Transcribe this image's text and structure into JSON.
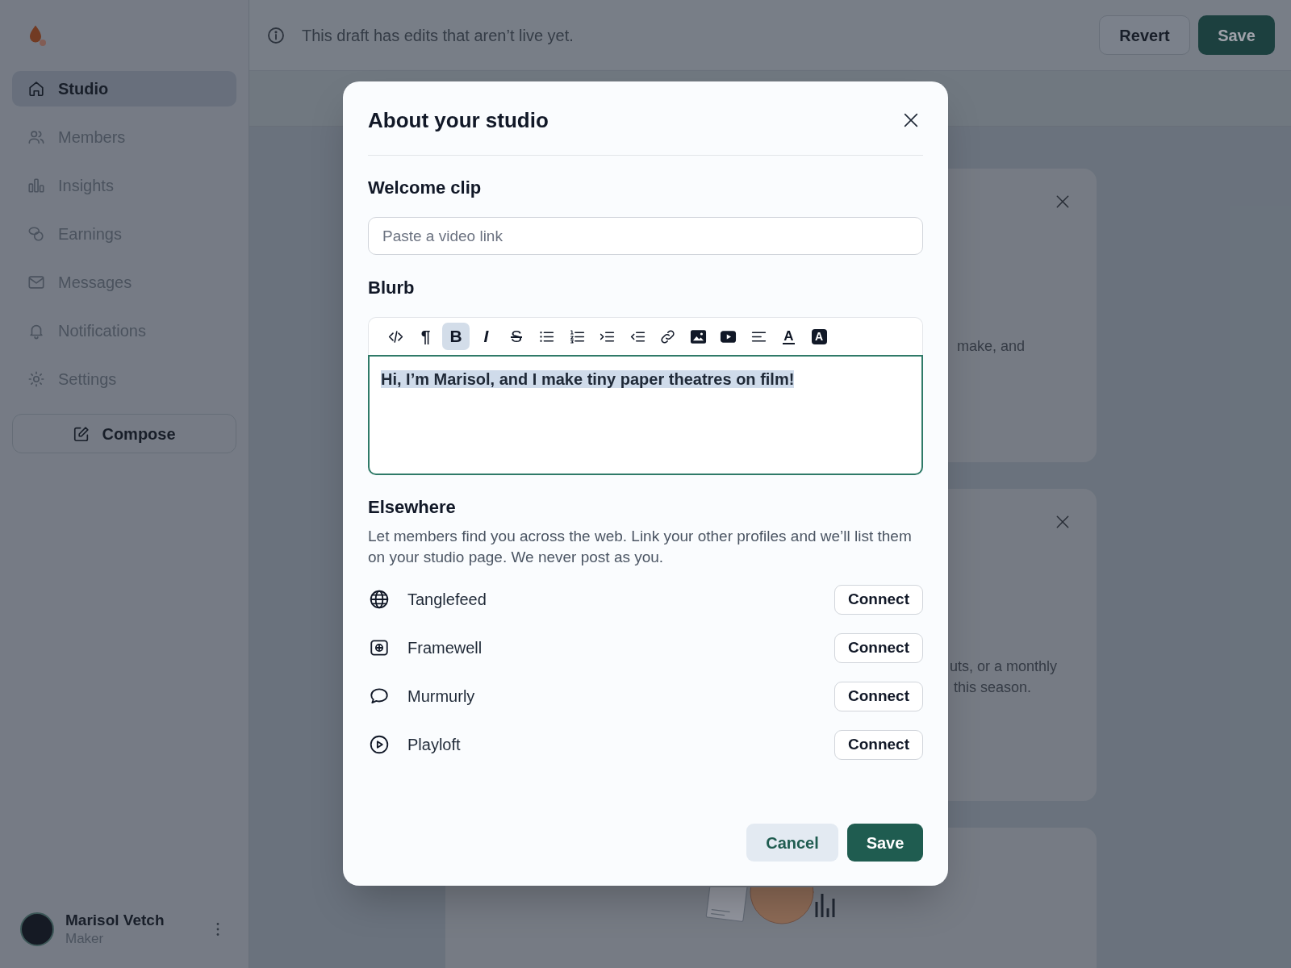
{
  "sidebar": {
    "items": [
      {
        "kind": "home",
        "label": "Studio",
        "selected": true
      },
      {
        "kind": "members",
        "label": "Members",
        "selected": false
      },
      {
        "kind": "insights",
        "label": "Insights",
        "selected": false
      },
      {
        "kind": "earnings",
        "label": "Earnings",
        "selected": false
      },
      {
        "kind": "messages",
        "label": "Messages",
        "selected": false
      },
      {
        "kind": "notifications",
        "label": "Notifications",
        "selected": false
      },
      {
        "kind": "settings",
        "label": "Settings",
        "selected": false
      }
    ],
    "compose": {
      "label": "Compose"
    },
    "user": {
      "name": "Marisol Vetch",
      "role": "Maker"
    }
  },
  "draft_bar": {
    "message": "This draft has edits that aren’t live yet.",
    "buttons": [
      {
        "kind": "secondary",
        "label": "Revert"
      },
      {
        "kind": "primary",
        "label": "Save"
      }
    ]
  },
  "background_cards": [
    {
      "kind": "text",
      "dismissible": true,
      "lines": [
        "make, and"
      ]
    },
    {
      "kind": "text",
      "dismissible": true,
      "lines": [
        "uts, or a monthly",
        "this season."
      ]
    },
    {
      "kind": "illustration",
      "dismissible": false
    }
  ],
  "modal": {
    "title": "About your studio",
    "welcome_clip": {
      "heading": "Welcome clip",
      "placeholder": "Paste a video link"
    },
    "blurb": {
      "heading": "Blurb",
      "toolbar": [
        {
          "kind": "code",
          "selected": false
        },
        {
          "kind": "paragraph",
          "label": "¶",
          "selected": false
        },
        {
          "kind": "bold",
          "label": "B",
          "selected": true
        },
        {
          "kind": "italic",
          "label": "I",
          "selected": false
        },
        {
          "kind": "strike",
          "label": "S",
          "selected": false
        },
        {
          "kind": "bullets",
          "selected": false
        },
        {
          "kind": "numbers",
          "selected": false
        },
        {
          "kind": "indent",
          "selected": false
        },
        {
          "kind": "outdent",
          "selected": false
        },
        {
          "kind": "link",
          "selected": false
        },
        {
          "kind": "image",
          "selected": false
        },
        {
          "kind": "video",
          "selected": false
        },
        {
          "kind": "align",
          "selected": false
        },
        {
          "kind": "text-color",
          "label": "A",
          "selected": false
        },
        {
          "kind": "highlight",
          "label": "A",
          "selected": false
        }
      ],
      "value": "Hi, I’m Marisol, and I make tiny paper theatres on film!",
      "selected": true,
      "focused": true
    },
    "elsewhere": {
      "heading": "Elsewhere",
      "description": "Let members find you across the web. Link your other profiles and we’ll list them on your studio page. We never post as you.",
      "links": [
        {
          "kind": "globe",
          "name": "Tanglefeed",
          "action": "Connect"
        },
        {
          "kind": "frame",
          "name": "Framewell",
          "action": "Connect"
        },
        {
          "kind": "chat",
          "name": "Murmurly",
          "action": "Connect"
        },
        {
          "kind": "play",
          "name": "Playloft",
          "action": "Connect"
        }
      ]
    },
    "buttons": [
      {
        "kind": "secondary",
        "label": "Cancel"
      },
      {
        "kind": "primary",
        "label": "Save"
      }
    ]
  }
}
